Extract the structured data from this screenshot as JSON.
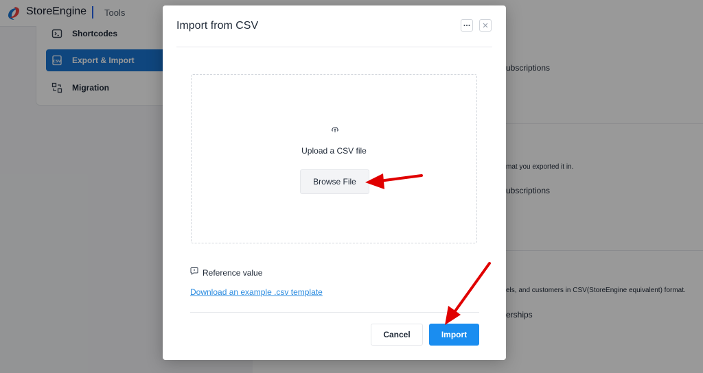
{
  "header": {
    "brand": "StoreEngine",
    "section": "Tools"
  },
  "sidebar": {
    "items": [
      {
        "label": "Shortcodes",
        "icon": "code-icon",
        "active": false
      },
      {
        "label": "Export & Import",
        "icon": "csv-file-icon",
        "active": true
      },
      {
        "label": "Migration",
        "icon": "migration-icon",
        "active": false
      }
    ]
  },
  "background": {
    "texts": [
      "ubscriptions",
      "mat you exported it in.",
      "ubscriptions",
      "els, and customers in CSV(StoreEngine equivalent) format.",
      "erships"
    ]
  },
  "modal": {
    "title": "Import from CSV",
    "more_icon": "ellipsis-icon",
    "close_icon": "close-icon",
    "upload": {
      "icon": "cloud-upload-icon",
      "text": "Upload a CSV file",
      "browse_label": "Browse File"
    },
    "reference": {
      "icon": "message-info-icon",
      "label": "Reference value",
      "link": "Download an example .csv template"
    },
    "cancel_label": "Cancel",
    "import_label": "Import"
  },
  "colors": {
    "primary": "#1a8df0",
    "link": "#2a8be0",
    "sidebar_active": "#1976d2",
    "annotation_arrow": "#e00000"
  }
}
